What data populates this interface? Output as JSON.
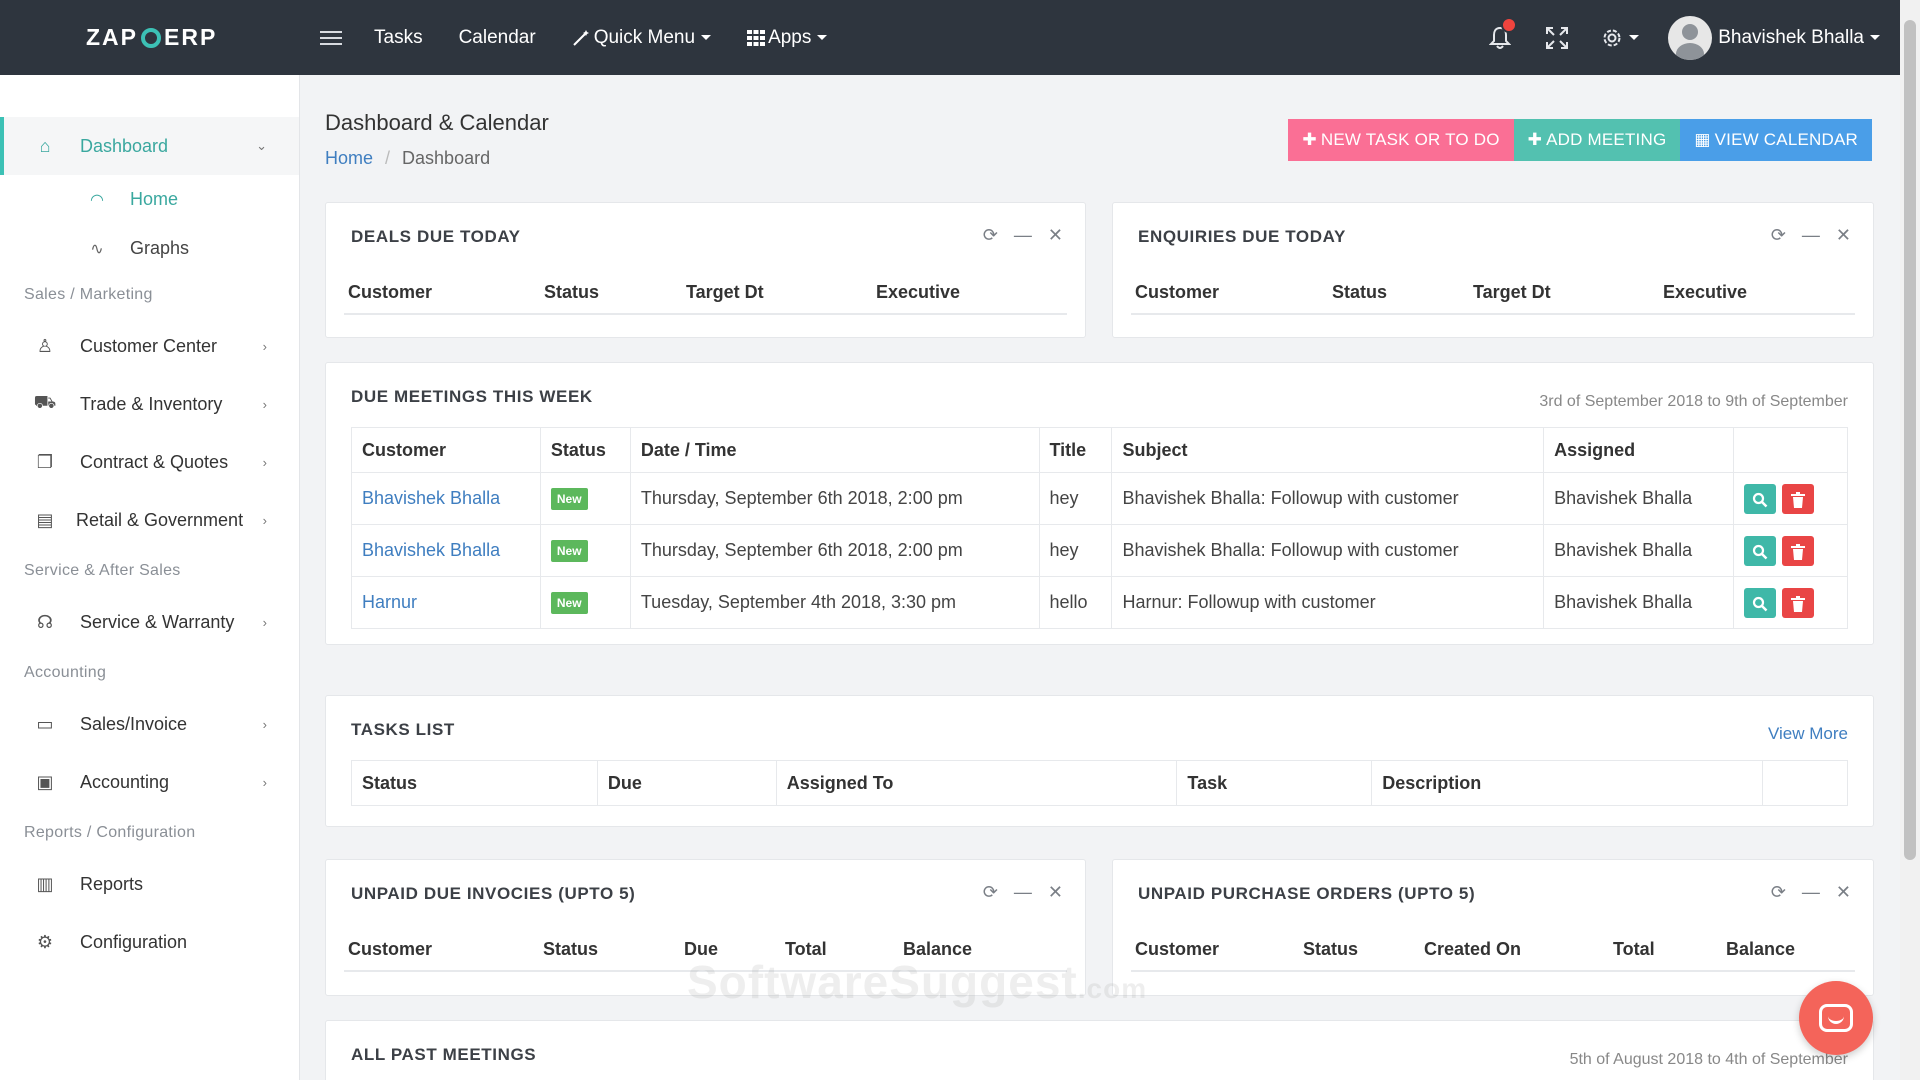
{
  "topbar": {
    "logo_left": "ZAP",
    "logo_right": "ERP",
    "nav": {
      "tasks": "Tasks",
      "calendar": "Calendar",
      "quick_menu": "Quick Menu",
      "apps": "Apps"
    },
    "user_name": "Bhavishek Bhalla",
    "icons": [
      "bell-icon",
      "fullscreen-icon",
      "gear-icon"
    ]
  },
  "sidebar": {
    "dashboard": "Dashboard",
    "home": "Home",
    "graphs": "Graphs",
    "sec_sales": "Sales / Marketing",
    "customer_center": "Customer Center",
    "trade_inventory": "Trade & Inventory",
    "contract_quotes": "Contract & Quotes",
    "retail_government": "Retail & Government",
    "sec_service": "Service & After Sales",
    "service_warranty": "Service & Warranty",
    "sec_accounting": "Accounting",
    "sales_invoice": "Sales/Invoice",
    "accounting": "Accounting",
    "sec_reports": "Reports / Configuration",
    "reports": "Reports",
    "configuration": "Configuration"
  },
  "header": {
    "title": "Dashboard & Calendar",
    "breadcrumb_home": "Home",
    "breadcrumb_current": "Dashboard",
    "btn_new_task": "NEW TASK OR TO DO",
    "btn_add_meeting": "ADD MEETING",
    "btn_view_calendar": "VIEW CALENDAR"
  },
  "deals_today": {
    "title": "DEALS DUE TODAY",
    "cols": [
      "Customer",
      "Status",
      "Target Dt",
      "Executive"
    ]
  },
  "enquiries_today": {
    "title": "ENQUIRIES DUE TODAY",
    "cols": [
      "Customer",
      "Status",
      "Target Dt",
      "Executive"
    ]
  },
  "meetings_week": {
    "title": "DUE MEETINGS THIS WEEK",
    "range": "3rd of September 2018 to 9th of September",
    "cols": [
      "Customer",
      "Status",
      "Date / Time",
      "Title",
      "Subject",
      "Assigned"
    ],
    "rows": [
      {
        "customer": "Bhavishek Bhalla",
        "status": "New",
        "datetime": "Thursday, September 6th 2018, 2:00 pm",
        "title": "hey",
        "subject": "Bhavishek Bhalla: Followup with customer",
        "assigned": "Bhavishek Bhalla"
      },
      {
        "customer": "Bhavishek Bhalla",
        "status": "New",
        "datetime": "Thursday, September 6th 2018, 2:00 pm",
        "title": "hey",
        "subject": "Bhavishek Bhalla: Followup with customer",
        "assigned": "Bhavishek Bhalla"
      },
      {
        "customer": "Harnur",
        "status": "New",
        "datetime": "Tuesday, September 4th 2018, 3:30 pm",
        "title": "hello",
        "subject": "Harnur: Followup with customer",
        "assigned": "Bhavishek Bhalla"
      }
    ]
  },
  "tasks_list": {
    "title": "TASKS LIST",
    "link": "View More",
    "cols": [
      "Status",
      "Due",
      "Assigned To",
      "Task",
      "Description"
    ]
  },
  "unpaid_invoices": {
    "title": "UNPAID DUE INVOCIES (UPTO 5)",
    "cols": [
      "Customer",
      "Status",
      "Due",
      "Total",
      "Balance"
    ]
  },
  "unpaid_po": {
    "title": "UNPAID PURCHASE ORDERS (UPTO 5)",
    "cols": [
      "Customer",
      "Status",
      "Created On",
      "Total",
      "Balance"
    ]
  },
  "past_meetings": {
    "title": "ALL PAST MEETINGS",
    "range": "5th of August 2018 to 4th of September"
  },
  "watermark": {
    "main": "SoftwareSuggest",
    "suffix": ".com"
  }
}
